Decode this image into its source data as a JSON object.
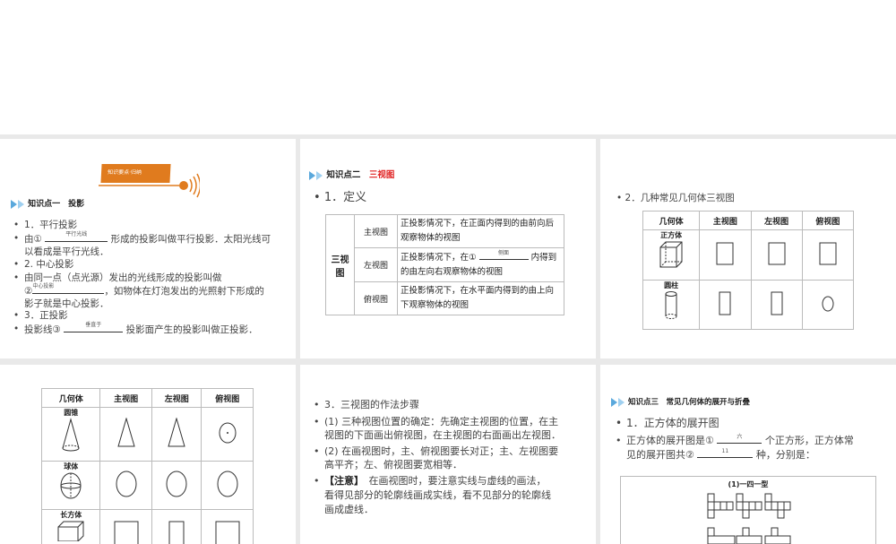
{
  "slide1": {
    "banner": "知识要点·归纳",
    "heading": "知识点一　投影",
    "items": [
      {
        "text": "1．平行投影"
      },
      {
        "pre": "由①",
        "answer": "平行光线",
        "post": "形成的投影叫做平行投影．太阳光线可",
        "line2": "以看成是平行光线．"
      },
      {
        "text": "2. 中心投影"
      },
      {
        "pre": "由同一点（点光源）发出的光线形成的投影叫做",
        "mark": "②",
        "answer": "中心投影",
        "post": "，如物体在灯泡发出的光照射下形成的",
        "line2": "影子就是中心投影．"
      },
      {
        "text": "3．正投影"
      },
      {
        "pre": "投影线③",
        "answer": "垂直于",
        "post": "投影面产生的投影叫做正投影．"
      }
    ]
  },
  "slide2": {
    "heading": "知识点二",
    "heading_red": "三视图",
    "subtitle": "1．定义",
    "group": "三视图",
    "rows": [
      {
        "name": "主视图",
        "desc": "正投影情况下，在正面内得到的由前向后观察物体的视图"
      },
      {
        "name": "左视图",
        "pre": "正投影情况下，在①",
        "answer": "侧面",
        "post": "内得到的由左向右观察物体的视图"
      },
      {
        "name": "俯视图",
        "desc": "正投影情况下，在水平面内得到的由上向下观察物体的视图"
      }
    ]
  },
  "slide3": {
    "subtitle": "2．几种常见几何体三视图",
    "headers": [
      "几何体",
      "主视图",
      "左视图",
      "俯视图"
    ],
    "rows": [
      "正方体",
      "圆柱"
    ]
  },
  "slide4": {
    "headers": [
      "几何体",
      "主视图",
      "左视图",
      "俯视图"
    ],
    "rows": [
      "圆锥",
      "球体",
      "长方体"
    ]
  },
  "slide5": {
    "items": [
      "3．三视图的作法步骤",
      "(1) 三种视图位置的确定：先确定主视图的位置，在主|视图的下面画出俯视图，在主视图的右面画出左视图．",
      "(2) 在画视图时，主、俯视图要长对正；主、左视图要|高平齐；左、俯视图要宽相等．"
    ],
    "note_label": "【注意】",
    "note": "在画视图时，要注意实线与虚线的画法，",
    "note_l2": "看得见部分的轮廓线画成实线，看不见部分的轮廓线",
    "note_l3": "画成虚线．"
  },
  "slide6": {
    "heading": "知识点三　常见几何体的展开与折叠",
    "subtitle": "1．正方体的展开图",
    "pre": "正方体的展开图是①",
    "answer1": "六",
    "mid": "个正方形，正方体常",
    "l2pre": "见的展开图共②",
    "answer2": "11",
    "l2post": "种，分别是：",
    "figure_title": "(1)一四一型"
  },
  "colors": {
    "accent_orange": "#e07b1e",
    "heading_red": "#e02020",
    "arrow_blue": "#5aa8dc"
  }
}
